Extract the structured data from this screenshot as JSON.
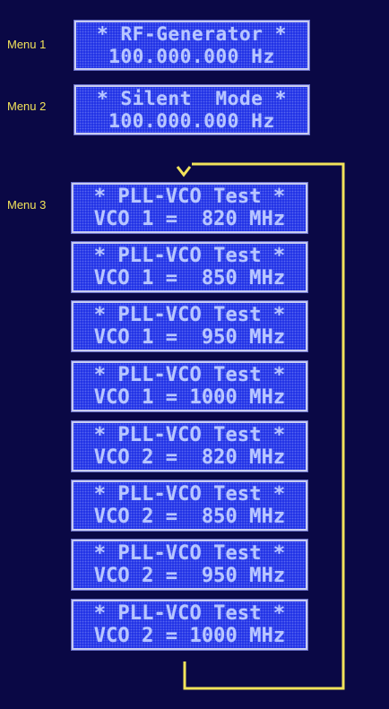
{
  "colors": {
    "background": "#0a0845",
    "lcd_fill": "#2233e6",
    "lcd_text": "#b8c6ff",
    "lcd_border": "#c8ccf0",
    "label": "#f2e35a",
    "loop_arrow": "#f2e35a"
  },
  "menus": [
    {
      "label": "Menu 1",
      "screens": [
        {
          "line1": "* RF-Generator *",
          "line2": "100.000.000 Hz"
        }
      ]
    },
    {
      "label": "Menu 2",
      "screens": [
        {
          "line1": "* Silent  Mode *",
          "line2": "100.000.000 Hz"
        }
      ]
    },
    {
      "label": "Menu 3",
      "screens": [
        {
          "line1": "* PLL-VCO Test *",
          "line2": "VCO 1 =  820 MHz"
        },
        {
          "line1": "* PLL-VCO Test *",
          "line2": "VCO 1 =  850 MHz"
        },
        {
          "line1": "* PLL-VCO Test *",
          "line2": "VCO 1 =  950 MHz"
        },
        {
          "line1": "* PLL-VCO Test *",
          "line2": "VCO 1 = 1000 MHz"
        },
        {
          "line1": "* PLL-VCO Test *",
          "line2": "VCO 2 =  820 MHz"
        },
        {
          "line1": "* PLL-VCO Test *",
          "line2": "VCO 2 =  850 MHz"
        },
        {
          "line1": "* PLL-VCO Test *",
          "line2": "VCO 2 =  950 MHz"
        },
        {
          "line1": "* PLL-VCO Test *",
          "line2": "VCO 2 = 1000 MHz"
        }
      ]
    }
  ]
}
